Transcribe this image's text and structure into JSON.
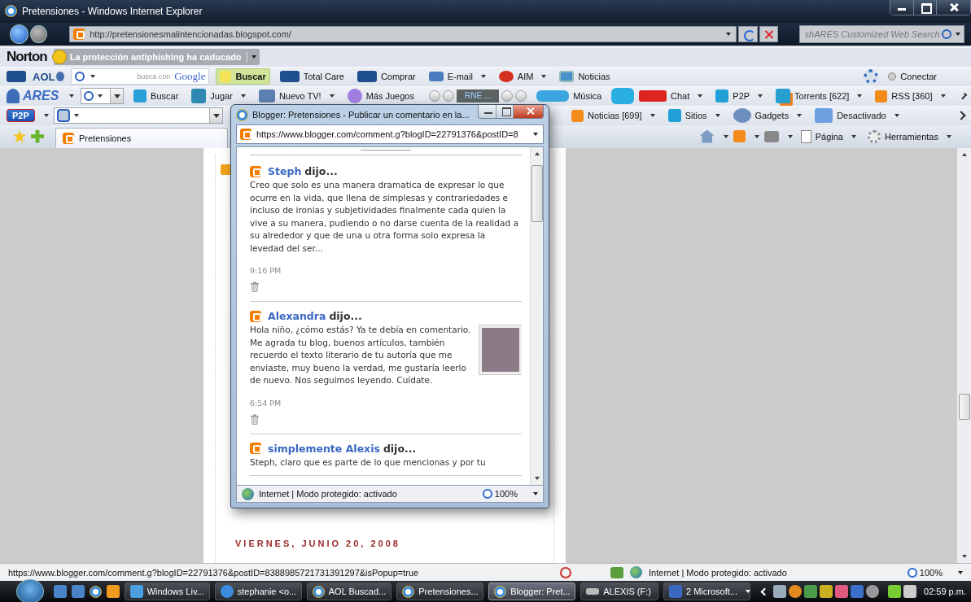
{
  "window": {
    "title": "Pretensiones - Windows Internet Explorer"
  },
  "address_bar": {
    "url": "http://pretensionesmalintencionadas.blogspot.com/",
    "search_placeholder": "shARES Customized Web Search"
  },
  "norton_bar": {
    "brand": "Norton",
    "alert": "La protección antiphishing ha caducado"
  },
  "aol_bar": {
    "brand": "AOL",
    "search_hint": "busca con",
    "search_logo": "Google",
    "search_button": "Buscar",
    "items": [
      {
        "label": "Total Care",
        "dropdown": false
      },
      {
        "label": "Comprar",
        "dropdown": false
      },
      {
        "label": "E-mail",
        "dropdown": true
      },
      {
        "label": "AIM",
        "dropdown": true
      },
      {
        "label": "Noticias",
        "dropdown": false
      }
    ],
    "connect": "Conectar"
  },
  "ares_bar": {
    "brand": "ARES",
    "search_button": "Buscar",
    "items": [
      {
        "label": "Jugar",
        "dropdown": true
      },
      {
        "label": "Nuevo TV!",
        "dropdown": true
      },
      {
        "label": "Más Juegos",
        "dropdown": false
      }
    ],
    "radio_station": "RNE ...",
    "right_items": [
      {
        "label": "Música",
        "dropdown": false
      },
      {
        "label": "Chat",
        "dropdown": true
      },
      {
        "label": "P2P",
        "dropdown": true
      },
      {
        "label": "Torrents [622]",
        "dropdown": true
      },
      {
        "label": "RSS [360]",
        "dropdown": true
      }
    ]
  },
  "p2p_bar": {
    "brand": "P2P",
    "items": [
      {
        "label": "Noticias [699]",
        "dropdown": true
      },
      {
        "label": "Sitios",
        "dropdown": true
      },
      {
        "label": "Gadgets",
        "dropdown": true
      },
      {
        "label": "Desactivado",
        "dropdown": true
      }
    ]
  },
  "tab_bar": {
    "tabs": [
      {
        "label": "Pretensiones",
        "selected": true
      }
    ],
    "commands": [
      {
        "label": "Página",
        "dropdown": true
      },
      {
        "label": "Herramientas",
        "dropdown": true
      }
    ]
  },
  "page": {
    "date_header": "VIERNES, JUNIO 20, 2008"
  },
  "popup": {
    "title": "Blogger: Pretensiones - Publicar un comentario en la...",
    "address": "https://www.blogger.com/comment.g?blogID=22791376&postID=8",
    "comments": [
      {
        "author": "Steph",
        "verb": "dijo...",
        "text": "Creo que solo es una manera dramatica de expresar lo que ocurre en la vida, que llena de simplesas y contrariedades e incluso de ironias y subjetividades finalmente cada quien la vive a su manera, pudiendo o no darse cuenta de la realidad a su alrededor y que de una u otra forma solo expresa la levedad del ser...",
        "time": "9:16 PM",
        "has_photo": false
      },
      {
        "author": "Alexandra",
        "verb": "dijo...",
        "text": "Hola niño, ¿cómo estás? Ya te debía en comentario. Me agrada tu blog, buenos artículos, también recuerdo el texto literario de tu autoría que me enviaste, muy bueno la verdad, me gustaría leerlo de nuevo. Nos seguimos leyendo. Cuídate.",
        "time": "6:54 PM",
        "has_photo": true
      },
      {
        "author": "simplemente Alexis",
        "verb": "dijo...",
        "text": "Steph, claro que es parte de lo que mencionas y por tu",
        "has_photo": false
      }
    ],
    "status": "Internet | Modo protegido: activado",
    "zoom": "100%"
  },
  "status_bar": {
    "url": "https://www.blogger.com/comment.g?blogID=22791376&postID=8388985721731391297&isPopup=true",
    "zone": "Internet | Modo protegido: activado",
    "zoom": "100%"
  },
  "taskbar": {
    "tasks": [
      {
        "label": "Windows Liv...",
        "selected": false,
        "dropdown": false
      },
      {
        "label": "stephanie <o...",
        "selected": false,
        "dropdown": false
      },
      {
        "label": "AOL Buscad...",
        "selected": false,
        "dropdown": false
      },
      {
        "label": "Pretensiones...",
        "selected": false,
        "dropdown": false
      },
      {
        "label": "Blogger: Pret...",
        "selected": true,
        "dropdown": false
      },
      {
        "label": "ALEXIS (F:)",
        "selected": false,
        "dropdown": false
      },
      {
        "label": "2 Microsoft...",
        "selected": false,
        "dropdown": true
      }
    ],
    "clock": "02:59 p.m."
  }
}
